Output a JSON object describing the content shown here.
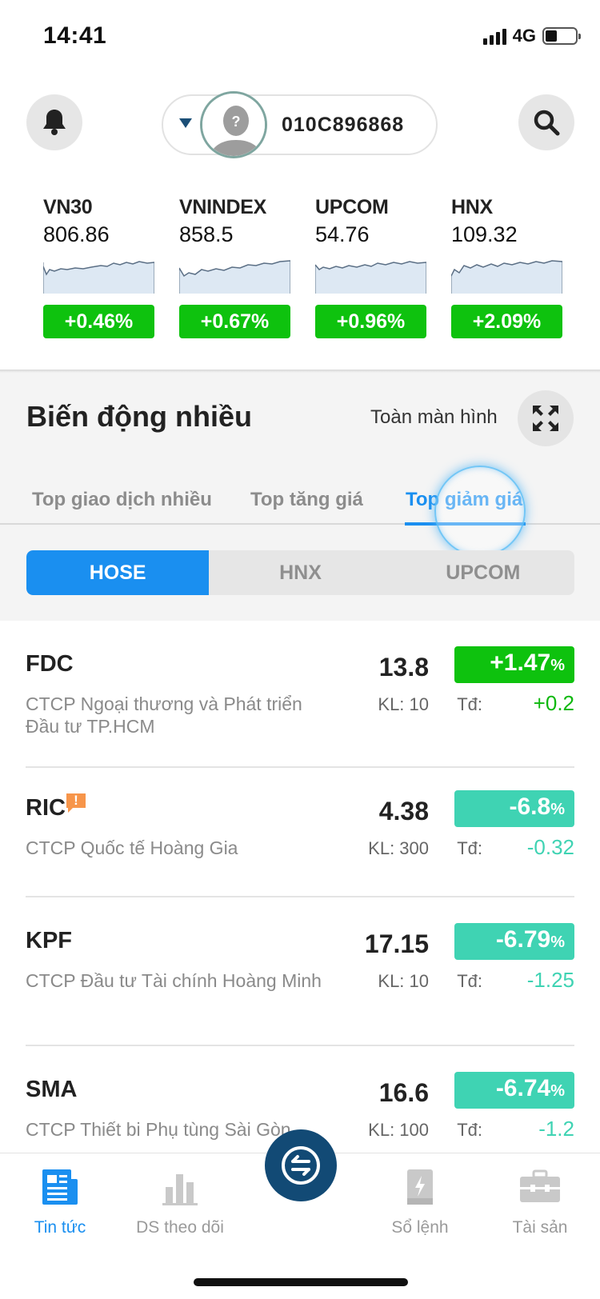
{
  "status_bar": {
    "time": "14:41",
    "network": "4G"
  },
  "header": {
    "account_id": "010C896868"
  },
  "indices": [
    {
      "name": "VN30",
      "value": "806.86",
      "change": "+0.46%"
    },
    {
      "name": "VNINDEX",
      "value": "858.5",
      "change": "+0.67%"
    },
    {
      "name": "UPCOM",
      "value": "54.76",
      "change": "+0.96%"
    },
    {
      "name": "HNX",
      "value": "109.32",
      "change": "+2.09%"
    }
  ],
  "section": {
    "title": "Biến động nhiều",
    "fullscreen_label": "Toàn màn hình",
    "tabs": [
      "Top giao dịch nhiều",
      "Top tăng giá",
      "Top giảm giá"
    ],
    "active_tab": "Top giảm giá",
    "exchanges": [
      "HOSE",
      "HNX",
      "UPCOM"
    ],
    "active_exchange": "HOSE"
  },
  "stocks": [
    {
      "symbol": "FDC",
      "name": "CTCP Ngoại thương và Phát triển Đầu tư TP.HCM",
      "price": "13.8",
      "volume": "KL: 10",
      "change_pct": "+1.47",
      "pct_sign": "%",
      "td_label": "Tđ:",
      "td_value": "+0.2",
      "warning": false
    },
    {
      "symbol": "RIC",
      "name": "CTCP Quốc tế Hoàng Gia",
      "price": "4.38",
      "volume": "KL: 300",
      "change_pct": "-6.8",
      "pct_sign": "%",
      "td_label": "Tđ:",
      "td_value": "-0.32",
      "warning": true,
      "warning_mark": "!"
    },
    {
      "symbol": "KPF",
      "name": "CTCP Đầu tư Tài chính Hoàng Minh",
      "price": "17.15",
      "volume": "KL: 10",
      "change_pct": "-6.79",
      "pct_sign": "%",
      "td_label": "Tđ:",
      "td_value": "-1.25",
      "warning": false
    },
    {
      "symbol": "SMA",
      "name": "CTCP Thiết bi Phụ tùng Sài Gòn",
      "price": "16.6",
      "volume": "KL: 100",
      "change_pct": "-6.74",
      "pct_sign": "%",
      "td_label": "Tđ:",
      "td_value": "-1.2",
      "warning": false
    }
  ],
  "bottom_nav": [
    {
      "label": "Tin tức",
      "icon": "news-icon"
    },
    {
      "label": "DS theo dõi",
      "icon": "watchlist-chart-icon"
    },
    {
      "label": "",
      "icon": "exchange-arrows-icon"
    },
    {
      "label": "Sổ lệnh",
      "icon": "order-book-icon"
    },
    {
      "label": "Tài sản",
      "icon": "briefcase-icon"
    }
  ],
  "colors": {
    "accent_blue": "#1a8ff0",
    "up_green": "#0ec20e",
    "down_teal": "#3fd3b3",
    "nav_dark_blue": "#124a75",
    "warning_orange": "#f7954a"
  }
}
